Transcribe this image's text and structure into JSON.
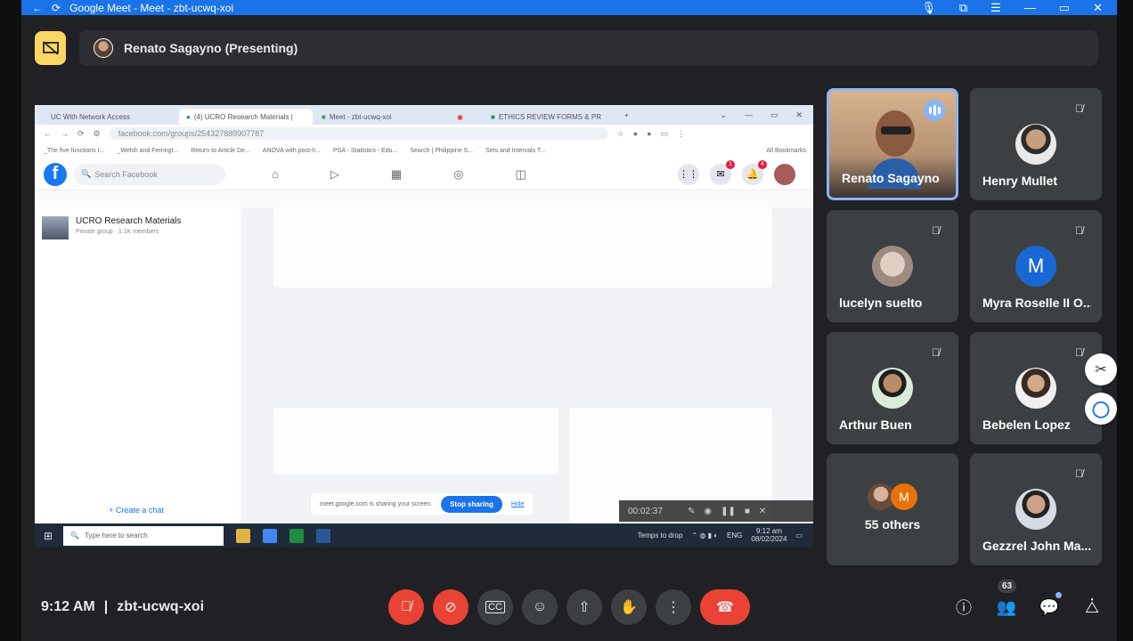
{
  "window": {
    "title": "Google Meet - Meet - zbt-ucwq-xoi"
  },
  "presenting": {
    "label": "Renato Sagayno (Presenting)"
  },
  "shared_screen": {
    "browser_tabs": [
      {
        "title": "UC With Network Access"
      },
      {
        "title": "(4) UCRO Research Materials |"
      },
      {
        "title": "Meet - zbt-ucwq-xoi"
      },
      {
        "title": ""
      },
      {
        "title": "ETHICS REVIEW FORMS & PR"
      }
    ],
    "url": "facebook.com/groups/254327889907787",
    "bookmarks": [
      "_The five functions t...",
      "_Welsh and Ferringt...",
      "Return to Article De...",
      "ANOVA with post-h...",
      "PSA - Statistics - Edu...",
      "Search | Philippine S...",
      "Sets and Intervals T..."
    ],
    "bookmarks_all": "All Bookmarks",
    "fb_search_placeholder": "Search Facebook",
    "fb_badges": {
      "messenger": "1",
      "notifications": "4"
    },
    "group_name": "UCRO Research Materials",
    "group_meta": "Private group · 1.1K members",
    "create_chat": "+ Create a chat",
    "sharing_text": "meet.google.com is sharing your screen.",
    "stop_sharing": "Stop sharing",
    "hide": "Hide",
    "rec_time": "00:02:37",
    "taskbar_search": "Type here to search",
    "taskbar_weather": "Temps to drop",
    "taskbar_lang": "ENG",
    "taskbar_time": "9:12 am",
    "taskbar_date": "08/02/2024"
  },
  "participants": [
    {
      "name": "Renato Sagayno",
      "speaking": true
    },
    {
      "name": "Henry Mullet",
      "muted": true
    },
    {
      "name": "lucelyn suelto",
      "muted": true
    },
    {
      "name": "Myra Roselle II O...",
      "muted": true,
      "initial": "M",
      "color": "#1967d2"
    },
    {
      "name": "Arthur Buen",
      "muted": true
    },
    {
      "name": "Bebelen Lopez",
      "muted": true
    },
    {
      "name": "55 others",
      "initial": "M",
      "color": "#e8710a"
    },
    {
      "name": "Gezzrel John Ma...",
      "muted": true
    }
  ],
  "footer": {
    "time": "9:12 AM",
    "separator": "|",
    "meeting_code": "zbt-ucwq-xoi",
    "people_count": "63"
  },
  "icons": [
    "back-arrow-icon",
    "refresh-icon",
    "mic-off-icon",
    "camera-off-icon",
    "captions-icon",
    "emoji-icon",
    "present-icon",
    "raise-hand-icon",
    "more-icon",
    "end-call-icon",
    "info-icon",
    "people-icon",
    "chat-icon",
    "activities-icon"
  ],
  "colors": {
    "accent": "#1a73e8",
    "danger": "#ea4335",
    "speaking": "#8ab4f8",
    "present_badge": "#fdd663"
  }
}
